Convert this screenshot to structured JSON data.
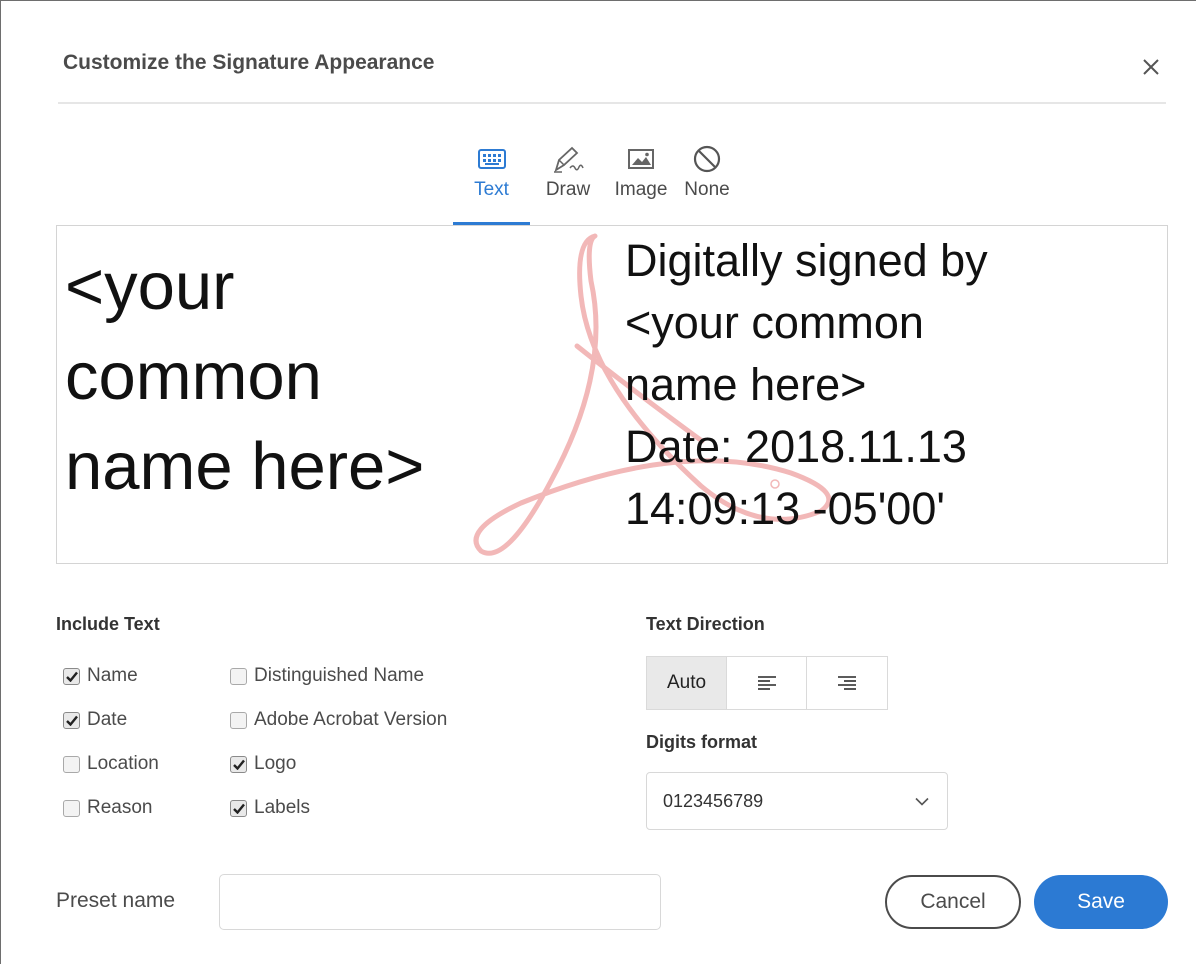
{
  "dialog": {
    "title": "Customize the Signature Appearance",
    "close_icon": "close-icon"
  },
  "tabs": [
    {
      "label": "Text",
      "icon": "keyboard-icon",
      "active": true
    },
    {
      "label": "Draw",
      "icon": "pen-icon",
      "active": false
    },
    {
      "label": "Image",
      "icon": "image-icon",
      "active": false
    },
    {
      "label": "None",
      "icon": "no-entry-icon",
      "active": false
    }
  ],
  "preview": {
    "name_lines": [
      "<your",
      "common",
      "name here>"
    ],
    "detail_lines": [
      "Digitally signed by",
      "<your common",
      "name here>",
      "Date: 2018.11.13",
      "14:09:13 -05'00'"
    ],
    "watermark": "adobe-acrobat-logo"
  },
  "include_text": {
    "heading": "Include Text",
    "options": [
      {
        "label": "Name",
        "checked": true
      },
      {
        "label": "Date",
        "checked": true
      },
      {
        "label": "Location",
        "checked": false
      },
      {
        "label": "Reason",
        "checked": false
      },
      {
        "label": "Distinguished Name",
        "checked": false
      },
      {
        "label": "Adobe Acrobat Version",
        "checked": false
      },
      {
        "label": "Logo",
        "checked": true
      },
      {
        "label": "Labels",
        "checked": true
      }
    ]
  },
  "text_direction": {
    "heading": "Text Direction",
    "auto_label": "Auto",
    "selected": "Auto",
    "align_left_icon": "align-left-icon",
    "align_right_icon": "align-right-icon"
  },
  "digits_format": {
    "heading": "Digits format",
    "value": "0123456789"
  },
  "footer": {
    "preset_label": "Preset name",
    "preset_value": "",
    "cancel_label": "Cancel",
    "save_label": "Save"
  },
  "colors": {
    "accent": "#2c7ad3",
    "topbar": "#2a5ea3",
    "watermark": "#f2b8b8"
  }
}
